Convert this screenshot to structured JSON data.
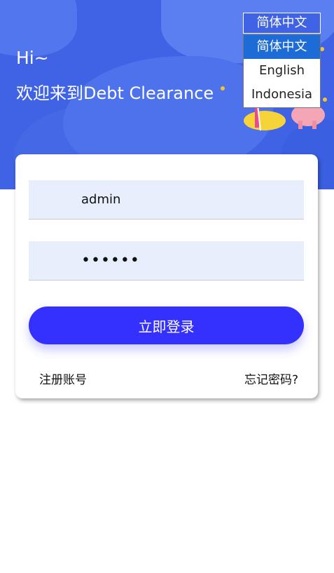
{
  "hero": {
    "greeting": "Hi~",
    "welcome": "欢迎来到Debt Clearance"
  },
  "language": {
    "current": "简体中文",
    "options": [
      {
        "label": "简体中文",
        "selected": true
      },
      {
        "label": "English",
        "selected": false
      },
      {
        "label": "Indonesia",
        "selected": false
      }
    ]
  },
  "login": {
    "username_value": "admin",
    "password_value": "••••••",
    "submit_label": "立即登录",
    "register_label": "注册账号",
    "forgot_label": "忘记密码?"
  },
  "colors": {
    "hero_bg": "#3f63e4",
    "primary_button": "#3431ff",
    "selected_option": "#1d6bd6",
    "input_bg": "#e8eefb"
  }
}
